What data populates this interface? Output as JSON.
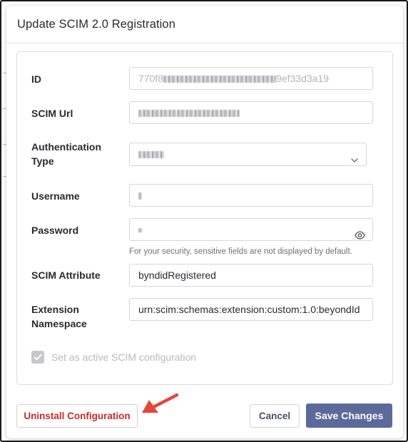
{
  "dialog": {
    "title": "Update SCIM 2.0 Registration"
  },
  "form": {
    "id": {
      "label": "ID",
      "value_prefix": "770f8",
      "value_suffix": "9ef33d3a19"
    },
    "scim_url": {
      "label": "SCIM Url"
    },
    "auth_type": {
      "label_line1": "Authentication",
      "label_line2": "Type",
      "icon": "chevron-down-icon"
    },
    "username": {
      "label": "Username"
    },
    "password": {
      "label": "Password",
      "helper": "For your security, sensitive fields are not displayed by default.",
      "icon": "eye-icon"
    },
    "scim_attribute": {
      "label": "SCIM Attribute",
      "value": "byndidRegistered"
    },
    "extension_namespace": {
      "label_line1": "Extension",
      "label_line2": "Namespace",
      "value": "urn:scim:schemas:extension:custom:1.0:beyondId"
    },
    "active": {
      "label": "Set as active SCIM configuration",
      "checked": true
    }
  },
  "footer": {
    "uninstall_label": "Uninstall Configuration",
    "cancel_label": "Cancel",
    "save_label": "Save Changes"
  },
  "colors": {
    "primary": "#5b6a9a",
    "danger": "#c92a2a",
    "annotation_arrow": "#e8453c"
  }
}
